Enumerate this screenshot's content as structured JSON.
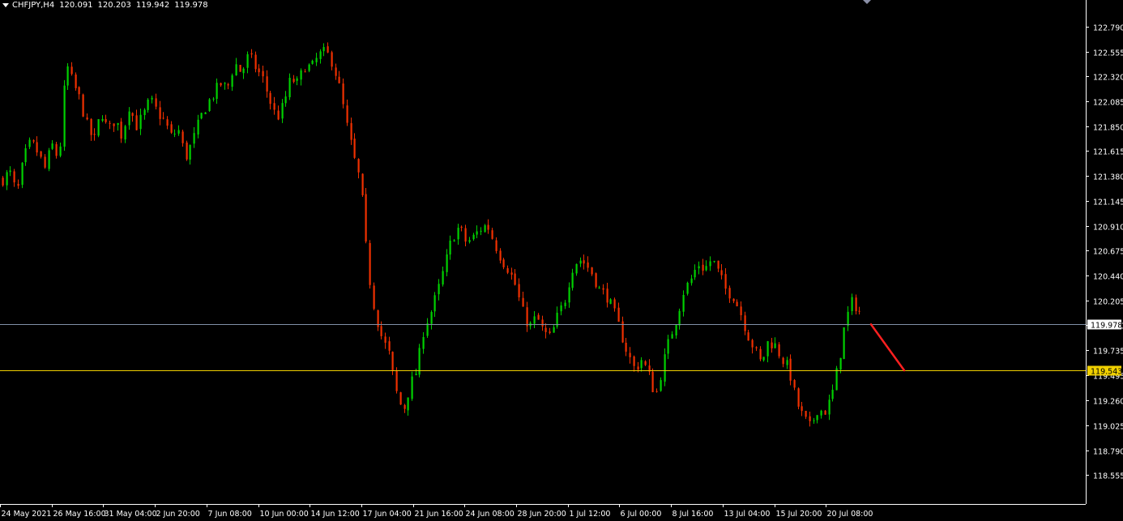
{
  "header": {
    "symbol": "CHFJPY,H4",
    "open": "120.091",
    "high": "120.203",
    "low": "119.942",
    "close": "119.978"
  },
  "colors": {
    "background": "#000000",
    "bull": "#00d000",
    "bear": "#f03000",
    "axis": "#ffffff",
    "bid_line": "#8090a8",
    "support_line": "#f0d000",
    "arrow": "#ff2020"
  },
  "chart_data": {
    "type": "candlestick",
    "y_ticks": [
      "122.790",
      "122.555",
      "122.320",
      "122.085",
      "121.850",
      "121.615",
      "121.380",
      "121.145",
      "120.910",
      "120.675",
      "120.440",
      "120.205",
      "119.970",
      "119.735",
      "119.495",
      "119.260",
      "119.025",
      "118.790",
      "118.555"
    ],
    "y_range": [
      118.45,
      122.98
    ],
    "x_labels": [
      "24 May 2021",
      "26 May 16:00",
      "31 May 04:00",
      "2 Jun 20:00",
      "7 Jun 08:00",
      "10 Jun 00:00",
      "14 Jun 12:00",
      "17 Jun 04:00",
      "21 Jun 16:00",
      "24 Jun 08:00",
      "28 Jun 20:00",
      "1 Jul 12:00",
      "6 Jul 00:00",
      "8 Jul 16:00",
      "13 Jul 04:00",
      "15 Jul 20:00",
      "20 Jul 08:00"
    ],
    "price_labels": {
      "current": "119.978",
      "level": "119.543"
    },
    "bid_price": 119.978,
    "level_price": 119.543,
    "arrow": {
      "from_price": 119.978,
      "to_price": 119.543
    },
    "path": [
      121.35,
      121.42,
      121.2,
      121.55,
      121.7,
      121.6,
      121.45,
      121.68,
      121.52,
      122.45,
      122.25,
      122.1,
      121.85,
      121.7,
      122.0,
      121.8,
      121.92,
      121.75,
      122.05,
      121.85,
      121.95,
      122.1,
      121.98,
      121.9,
      121.75,
      121.82,
      121.55,
      121.7,
      121.9,
      122.05,
      122.15,
      122.25,
      122.2,
      122.45,
      122.35,
      122.52,
      122.4,
      122.3,
      122.1,
      121.92,
      122.05,
      122.3,
      122.25,
      122.42,
      122.4,
      122.52,
      122.55,
      122.45,
      122.2,
      121.85,
      121.55,
      121.3,
      120.5,
      120.1,
      119.85,
      119.7,
      119.35,
      119.15,
      119.4,
      119.55,
      119.95,
      120.1,
      120.3,
      120.55,
      120.8,
      120.9,
      120.75,
      120.8,
      120.88,
      120.92,
      120.75,
      120.6,
      120.5,
      120.35,
      120.1,
      119.95,
      120.05,
      119.9,
      119.85,
      120.05,
      120.2,
      120.5,
      120.6,
      120.55,
      120.45,
      120.3,
      120.25,
      120.1,
      119.9,
      119.7,
      119.55,
      119.65,
      119.5,
      119.3,
      119.6,
      119.85,
      120.05,
      120.3,
      120.4,
      120.55,
      120.5,
      120.6,
      120.45,
      120.3,
      120.25,
      120.1,
      119.9,
      119.75,
      119.6,
      119.82,
      119.78,
      119.65,
      119.55,
      119.25,
      119.1,
      119.0,
      119.18,
      119.15,
      119.28,
      119.6,
      120.0,
      120.2,
      120.1
    ]
  }
}
